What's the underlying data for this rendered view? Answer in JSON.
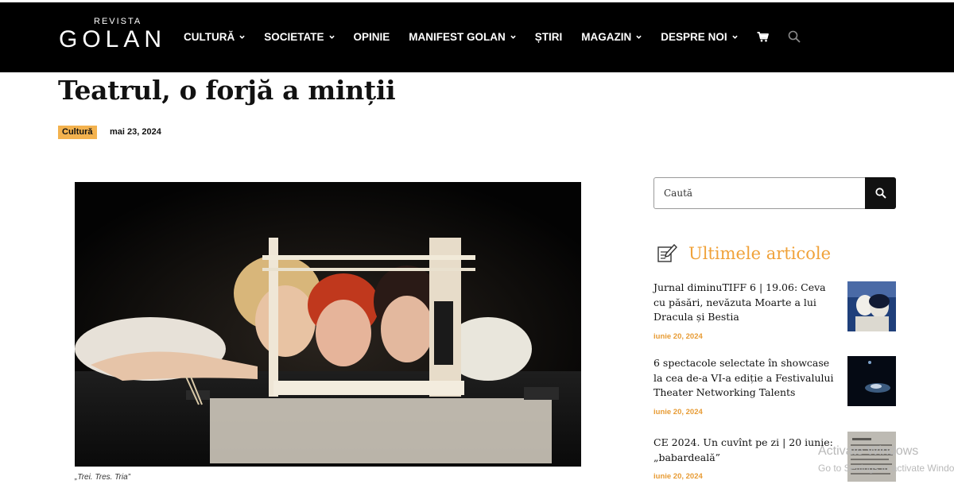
{
  "header": {
    "logo_small": "REVISTA",
    "logo_big": "GOLAN",
    "nav": [
      {
        "label": "CULTURĂ",
        "dropdown": true
      },
      {
        "label": "SOCIETATE",
        "dropdown": true
      },
      {
        "label": "OPINIE",
        "dropdown": false
      },
      {
        "label": "MANIFEST GOLAN",
        "dropdown": true
      },
      {
        "label": "ȘTIRI",
        "dropdown": false
      },
      {
        "label": "MAGAZIN",
        "dropdown": true
      },
      {
        "label": "DESPRE NOI",
        "dropdown": true
      }
    ],
    "icons": [
      "cart-icon",
      "search-icon"
    ]
  },
  "article": {
    "title": "Teatrul, o forjă a minții",
    "category": "Cultură",
    "date": "mai 23, 2024",
    "image_caption": "„Trei. Tres. Tria”"
  },
  "sidebar": {
    "search_placeholder": "Caută",
    "widget_title": "Ultimele articole",
    "posts": [
      {
        "title": "Jurnal diminuTIFF 6 | 19.06: Ceva cu păsări, nevăzuta Moarte a lui Dracula și Bestia",
        "date": "iunie 20, 2024"
      },
      {
        "title": "6 spectacole selectate în showcase la cea de-a VI-a ediție a Festivalului Theater Networking Talents",
        "date": "iunie 20, 2024"
      },
      {
        "title": "CE 2024. Un cuvînt pe zi | 20 iunie: „babardeală”",
        "date": "iunie 20, 2024"
      }
    ]
  },
  "overlay": {
    "watermark_title": "Activate Windows",
    "watermark_sub": "Go to Settings to activate Windows."
  },
  "colors": {
    "header_bg": "#000000",
    "accent": "#f3b24e",
    "date_accent": "#e79b34",
    "widget_title": "#f0a23a"
  }
}
